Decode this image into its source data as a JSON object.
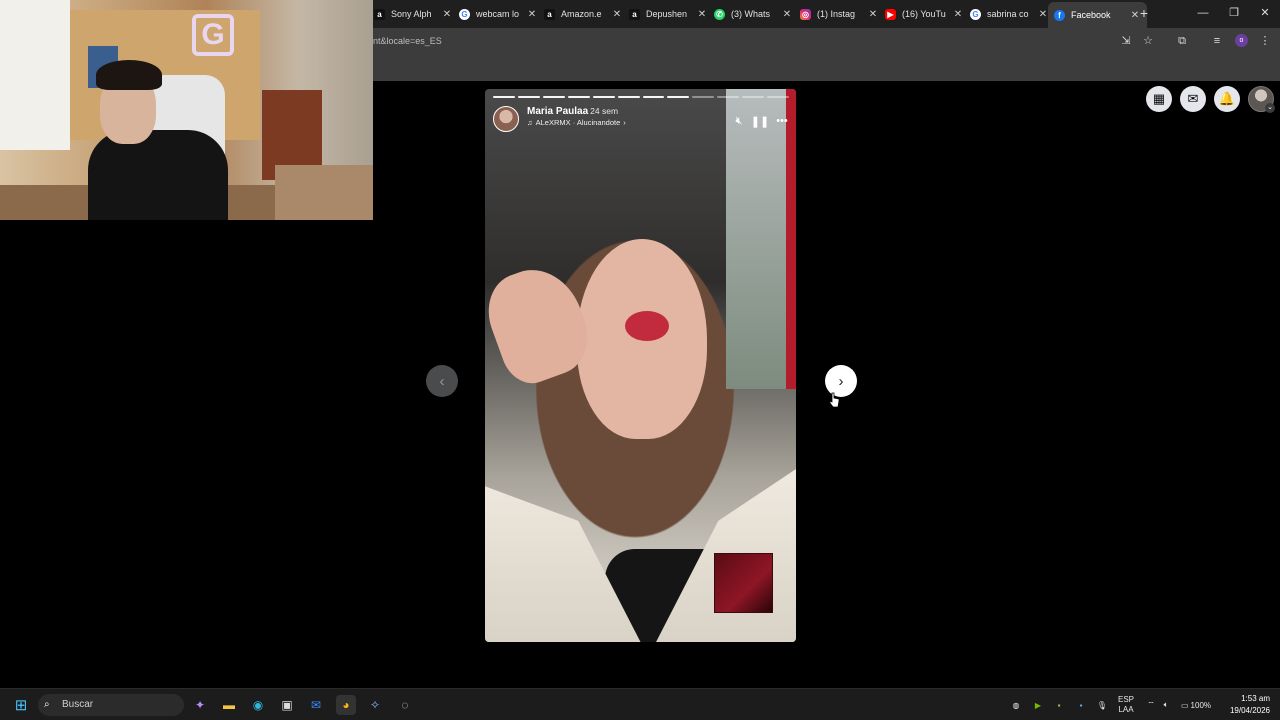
{
  "browser": {
    "tabs": [
      {
        "label": "Sony Alph",
        "icon": "amazon-icon"
      },
      {
        "label": "webcam lo",
        "icon": "google-icon"
      },
      {
        "label": "Amazon.e",
        "icon": "amazon-icon"
      },
      {
        "label": "Depushen",
        "icon": "amazon-icon"
      },
      {
        "label": "(3) Whats",
        "icon": "whatsapp-icon"
      },
      {
        "label": "(1) Instag",
        "icon": "instagram-icon"
      },
      {
        "label": "(16) YouTu",
        "icon": "youtube-icon"
      },
      {
        "label": "sabrina co",
        "icon": "google-icon"
      },
      {
        "label": "Facebook",
        "icon": "facebook-icon",
        "active": true
      }
    ],
    "address": "nt&locale=es_ES",
    "profile_initial": "o"
  },
  "story": {
    "author": "Maria Paulaa",
    "age": "24 sem",
    "music": "ALeXRMX · Alucinandote",
    "segments_total": 12,
    "segments_viewed": 8
  },
  "taskbar": {
    "search_placeholder": "Buscar",
    "lang_top": "ESP",
    "lang_bottom": "LAA",
    "battery": "100%",
    "time": "1:53 am",
    "date": "19/04/2026"
  },
  "colors": {
    "facebook": "#1877f2",
    "tab_bg": "#1f1f1f",
    "toolbar_bg": "#3c3c3c"
  }
}
